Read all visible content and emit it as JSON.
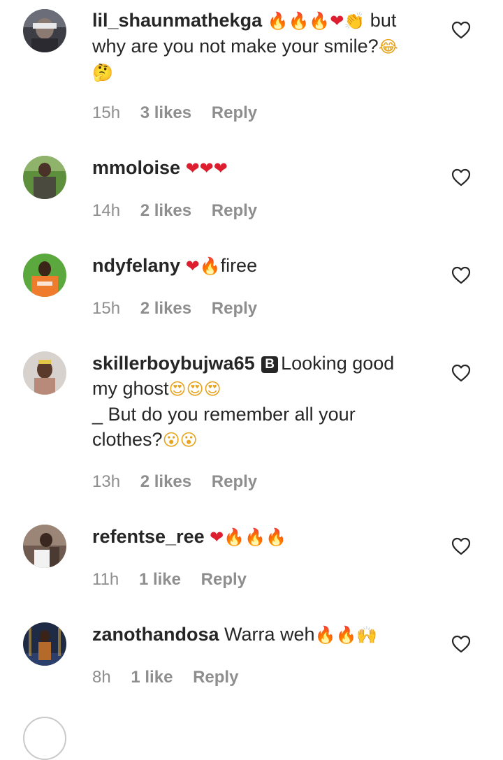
{
  "comments": [
    {
      "username": "lil_shaunmathekga",
      "line1_suffix": "but",
      "line2": "why are you not make your smile?",
      "time": "15h",
      "likes": "3 likes",
      "reply": "Reply",
      "icons": [
        "fire-emoji",
        "fire-emoji",
        "fire-emoji",
        "heart-emoji",
        "clapping-hands-emoji",
        "laughing-tears-emoji",
        "thinking-face-emoji"
      ]
    },
    {
      "username": "mmoloise",
      "time": "14h",
      "likes": "2 likes",
      "reply": "Reply",
      "icons": [
        "heart-emoji",
        "heart-emoji",
        "heart-emoji"
      ]
    },
    {
      "username": "ndyfelany",
      "text": "firee",
      "time": "15h",
      "likes": "2 likes",
      "reply": "Reply",
      "icons": [
        "heart-emoji",
        "fire-emoji"
      ]
    },
    {
      "username": "skillerboybujwa65",
      "badge": "B",
      "text_line1": "Looking good",
      "text_line2": "my ghost",
      "text_line3": "_ But do you remember all your",
      "text_line4": "clothes?",
      "time": "13h",
      "likes": "2 likes",
      "reply": "Reply",
      "icons": [
        "heart-eyes-emoji",
        "heart-eyes-emoji",
        "heart-eyes-emoji",
        "astonished-face-emoji",
        "astonished-face-emoji"
      ]
    },
    {
      "username": "refentse_ree",
      "time": "11h",
      "likes": "1 like",
      "reply": "Reply",
      "icons": [
        "heart-emoji",
        "fire-emoji",
        "fire-emoji",
        "fire-emoji"
      ]
    },
    {
      "username": "zanothandosa",
      "text": "Warra weh",
      "time": "8h",
      "likes": "1 like",
      "reply": "Reply",
      "icons": [
        "fire-emoji",
        "fire-emoji",
        "raising-hands-emoji"
      ]
    }
  ],
  "colors": {
    "text": "#262626",
    "meta": "#8e8e8e",
    "heart": "#dd1e2f",
    "fire": "#f28a12",
    "background": "#ffffff"
  },
  "action_icons": {
    "like": "heart-outline-icon"
  }
}
